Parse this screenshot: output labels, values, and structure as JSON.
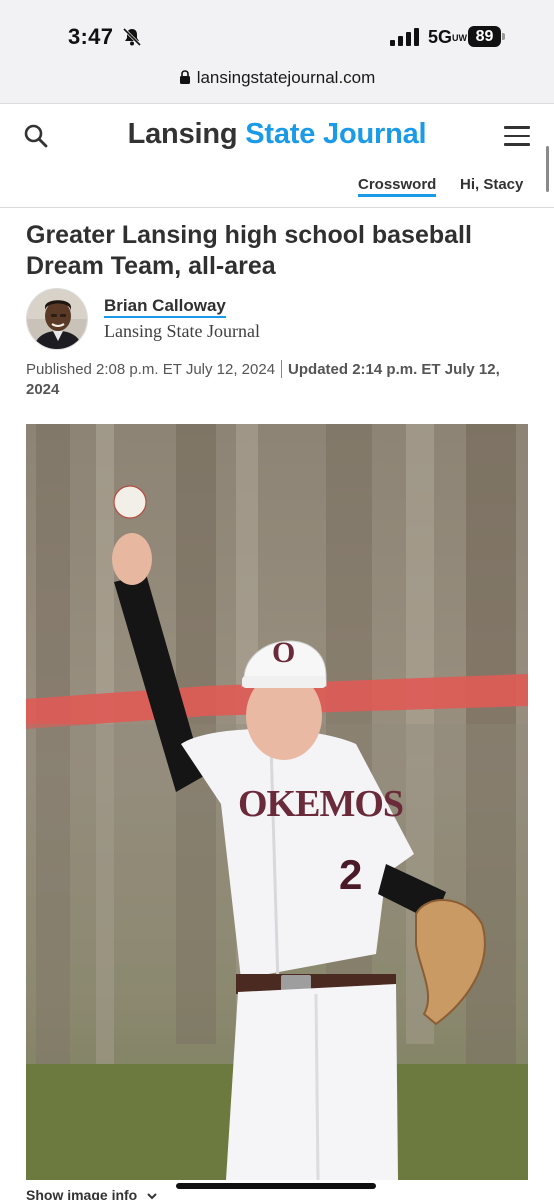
{
  "status_bar": {
    "time": "3:47",
    "network": "5G",
    "network_sub": "UW",
    "battery": "89"
  },
  "browser": {
    "url": "lansingstatejournal.com"
  },
  "header": {
    "brand_part1": "Lansing",
    "brand_part2": "State Journal",
    "crossword": "Crossword",
    "greeting": "Hi, Stacy",
    "accent_color": "#1b9ae8"
  },
  "article": {
    "headline": "Greater Lansing high school baseball Dream Team, all-area",
    "author": {
      "name": "Brian Calloway",
      "organization": "Lansing State Journal"
    },
    "published": "Published 2:08 p.m. ET July 12, 2024",
    "updated": "Updated 2:14 p.m. ET July 12, 2024",
    "photo": {
      "jersey_text": "OKEMOS",
      "jersey_number": "2",
      "cap_letter": "O"
    },
    "show_image_info": "Show image info"
  },
  "icons": [
    "bell-slash-icon",
    "signal-icon",
    "lock-icon",
    "search-icon",
    "hamburger-menu-icon",
    "chevron-down-icon"
  ]
}
